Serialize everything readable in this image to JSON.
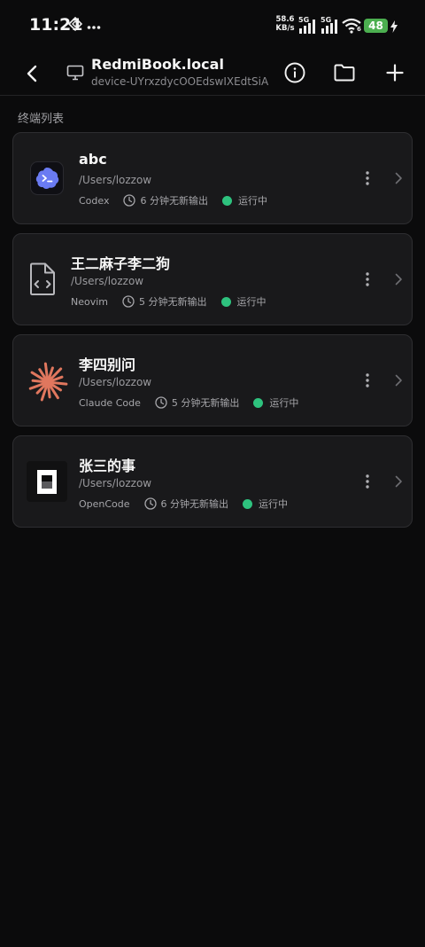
{
  "status_bar": {
    "time": "11:21",
    "net_speed_value": "58.6",
    "net_speed_unit": "KB/s",
    "sim1_label": "5G",
    "sim2_label": "5G",
    "wifi_badge": "6",
    "battery": "48"
  },
  "header": {
    "title": "RedmiBook.local",
    "subtitle": "device-UYrxzdycOOEdswIXEdtSiA"
  },
  "section_label": "终端列表",
  "terminals": [
    {
      "name": "abc",
      "path": "/Users/lozzow",
      "tool": "Codex",
      "idle": "6 分钟无新输出",
      "status": "运行中",
      "icon": "codex-icon"
    },
    {
      "name": "王二麻子李二狗",
      "path": "/Users/lozzow",
      "tool": "Neovim",
      "idle": "5 分钟无新输出",
      "status": "运行中",
      "icon": "code-file-icon"
    },
    {
      "name": "李四别问",
      "path": "/Users/lozzow",
      "tool": "Claude Code",
      "idle": "5 分钟无新输出",
      "status": "运行中",
      "icon": "claude-icon"
    },
    {
      "name": "张三的事",
      "path": "/Users/lozzow",
      "tool": "OpenCode",
      "idle": "6 分钟无新输出",
      "status": "运行中",
      "icon": "opencode-icon"
    }
  ],
  "colors": {
    "background": "#0b0b0c",
    "card": "#19191b",
    "running": "#2ec27e",
    "battery": "#4caf50",
    "claude_accent": "#e0775e",
    "codex_accent": "#6a7bf2"
  }
}
